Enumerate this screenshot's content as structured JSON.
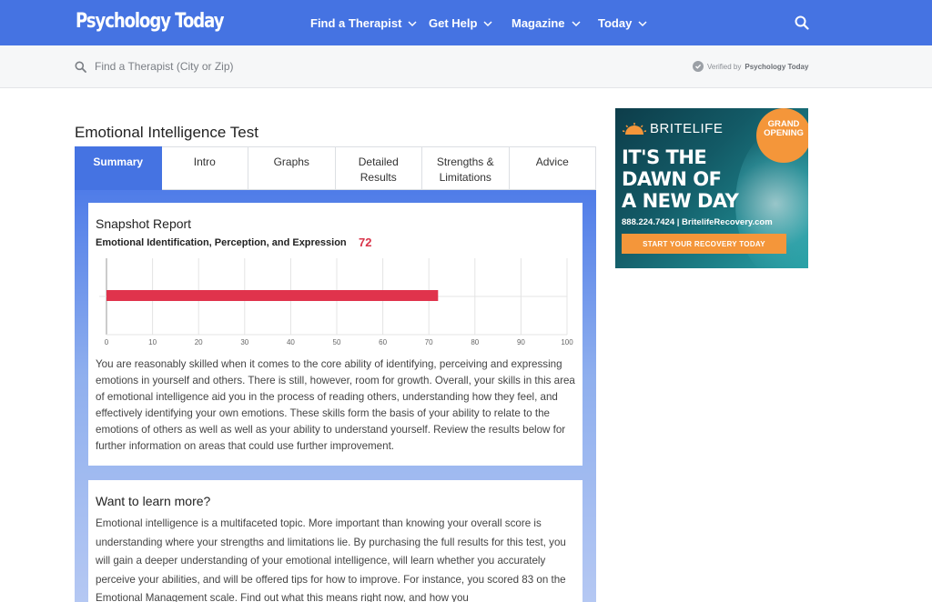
{
  "header": {
    "logo": "Psychology Today",
    "nav": [
      "Find a Therapist",
      "Get Help",
      "Magazine",
      "Today"
    ]
  },
  "search": {
    "placeholder": "Find a Therapist (City or Zip)",
    "verified_prefix": "Verified by",
    "verified_brand": "Psychology Today"
  },
  "page": {
    "title": "Emotional Intelligence Test",
    "tabs": [
      {
        "line1": "Summary",
        "line2": "",
        "active": true
      },
      {
        "line1": "Intro",
        "line2": ""
      },
      {
        "line1": "Graphs",
        "line2": ""
      },
      {
        "line1": "Detailed",
        "line2": "Results"
      },
      {
        "line1": "Strengths &",
        "line2": "Limitations"
      },
      {
        "line1": "Advice",
        "line2": ""
      }
    ]
  },
  "snapshot": {
    "title": "Snapshot Report",
    "metric_label": "Emotional Identification, Perception, and Expression",
    "score": "72",
    "text": "You are reasonably skilled when it comes to the core ability of identifying, perceiving and expressing emotions in yourself and others. There is still, however, room for growth. Overall, your skills in this area of emotional intelligence aid you in the process of reading others, understanding how they feel, and effectively identifying your own emotions. These skills form the basis of your ability to relate to the emotions of others as well as well as your ability to understand yourself. Review the results below for further information on areas that could use further improvement."
  },
  "learn": {
    "title": "Want to learn more?",
    "text": "Emotional intelligence is a multifaceted topic. More important than knowing your overall score is understanding where your strengths and limitations lie. By purchasing the full results for this test, you will gain a deeper understanding of your emotional intelligence, will learn whether you accurately perceive your abilities, and will be offered tips for how to improve. For instance, you scored 83 on the Emotional Management scale. Find out what this means right now, and how you"
  },
  "ad": {
    "brand": "BRITELIFE",
    "badge_line1": "GRAND",
    "badge_line2": "OPENING",
    "headline_1": "IT'S THE",
    "headline_2": "DAWN OF",
    "headline_3": "A NEW DAY",
    "phone": "888.224.7424 | BritelifeRecovery.com",
    "cta": "START YOUR RECOVERY TODAY"
  },
  "chart_data": {
    "type": "bar",
    "orientation": "horizontal",
    "categories": [
      "Emotional Identification, Perception, and Expression"
    ],
    "values": [
      72
    ],
    "xlim": [
      0,
      100
    ],
    "xticks": [
      0,
      10,
      20,
      30,
      40,
      50,
      60,
      70,
      80,
      90,
      100
    ],
    "grid": true,
    "bar_color": "#e0334c"
  },
  "colors": {
    "brand_blue": "#4573e2",
    "score_red": "#d9344a",
    "ad_orange": "#f4963a"
  }
}
